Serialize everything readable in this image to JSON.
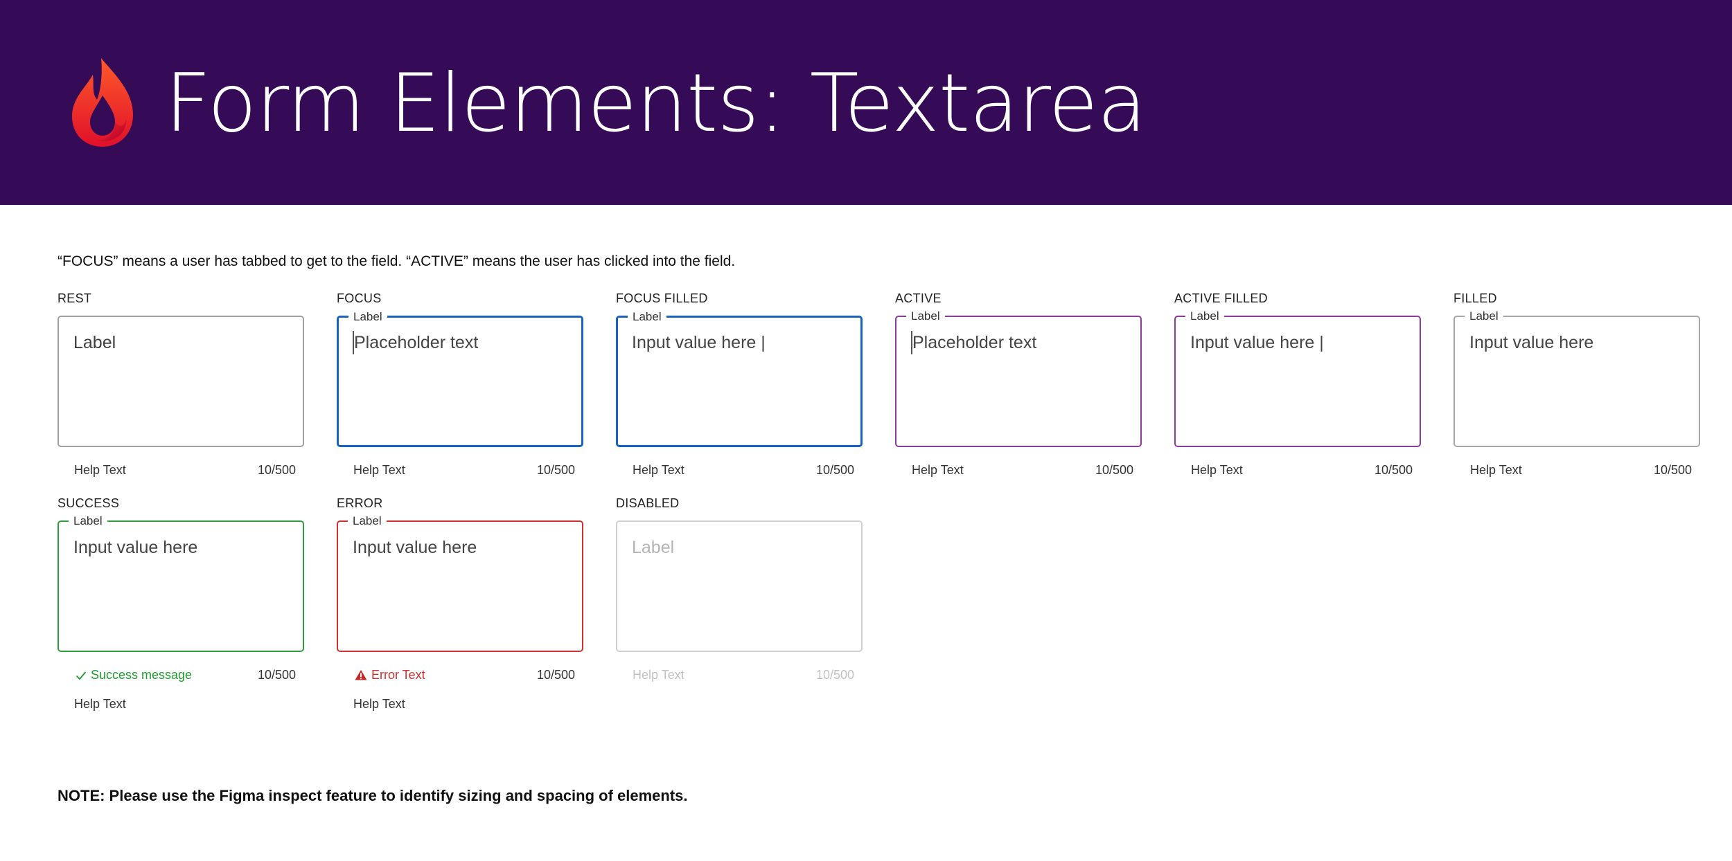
{
  "header": {
    "title": "Form Elements: Textarea",
    "logo_icon": "flame-icon",
    "background": "#350b57"
  },
  "intro": "“FOCUS” means a user has tabbed to get to the field. “ACTIVE” means the user has clicked into the field.",
  "note": "NOTE: Please use the Figma inspect feature to identify sizing and spacing of elements.",
  "colors": {
    "focus": "#1565c0",
    "active": "#8e3a9f",
    "success": "#2e9d3c",
    "error": "#d32f2f",
    "disabled": "#d0d0d0"
  },
  "states": {
    "rest": {
      "title": "REST",
      "content": "Label",
      "help": "Help Text",
      "counter": "10/500"
    },
    "focus": {
      "title": "FOCUS",
      "label": "Label",
      "content": "Placeholder text",
      "help": "Help Text",
      "counter": "10/500"
    },
    "focus_filled": {
      "title": "FOCUS FILLED",
      "label": "Label",
      "content": "Input value here |",
      "help": "Help Text",
      "counter": "10/500"
    },
    "active": {
      "title": "ACTIVE",
      "label": "Label",
      "content": "Placeholder text",
      "help": "Help Text",
      "counter": "10/500"
    },
    "active_filled": {
      "title": "ACTIVE FILLED",
      "label": "Label",
      "content": "Input value here |",
      "help": "Help Text",
      "counter": "10/500"
    },
    "filled": {
      "title": "FILLED",
      "label": "Label",
      "content": "Input value here",
      "help": "Help Text",
      "counter": "10/500"
    },
    "success": {
      "title": "SUCCESS",
      "label": "Label",
      "content": "Input value here",
      "message": "Success message",
      "message_icon": "check-icon",
      "help": "Help Text",
      "counter": "10/500"
    },
    "error": {
      "title": "ERROR",
      "label": "Label",
      "content": "Input value here",
      "message": "Error Text",
      "message_icon": "warning-icon",
      "help": "Help Text",
      "counter": "10/500"
    },
    "disabled": {
      "title": "DISABLED",
      "content": "Label",
      "help": "Help Text",
      "counter": "10/500"
    }
  }
}
